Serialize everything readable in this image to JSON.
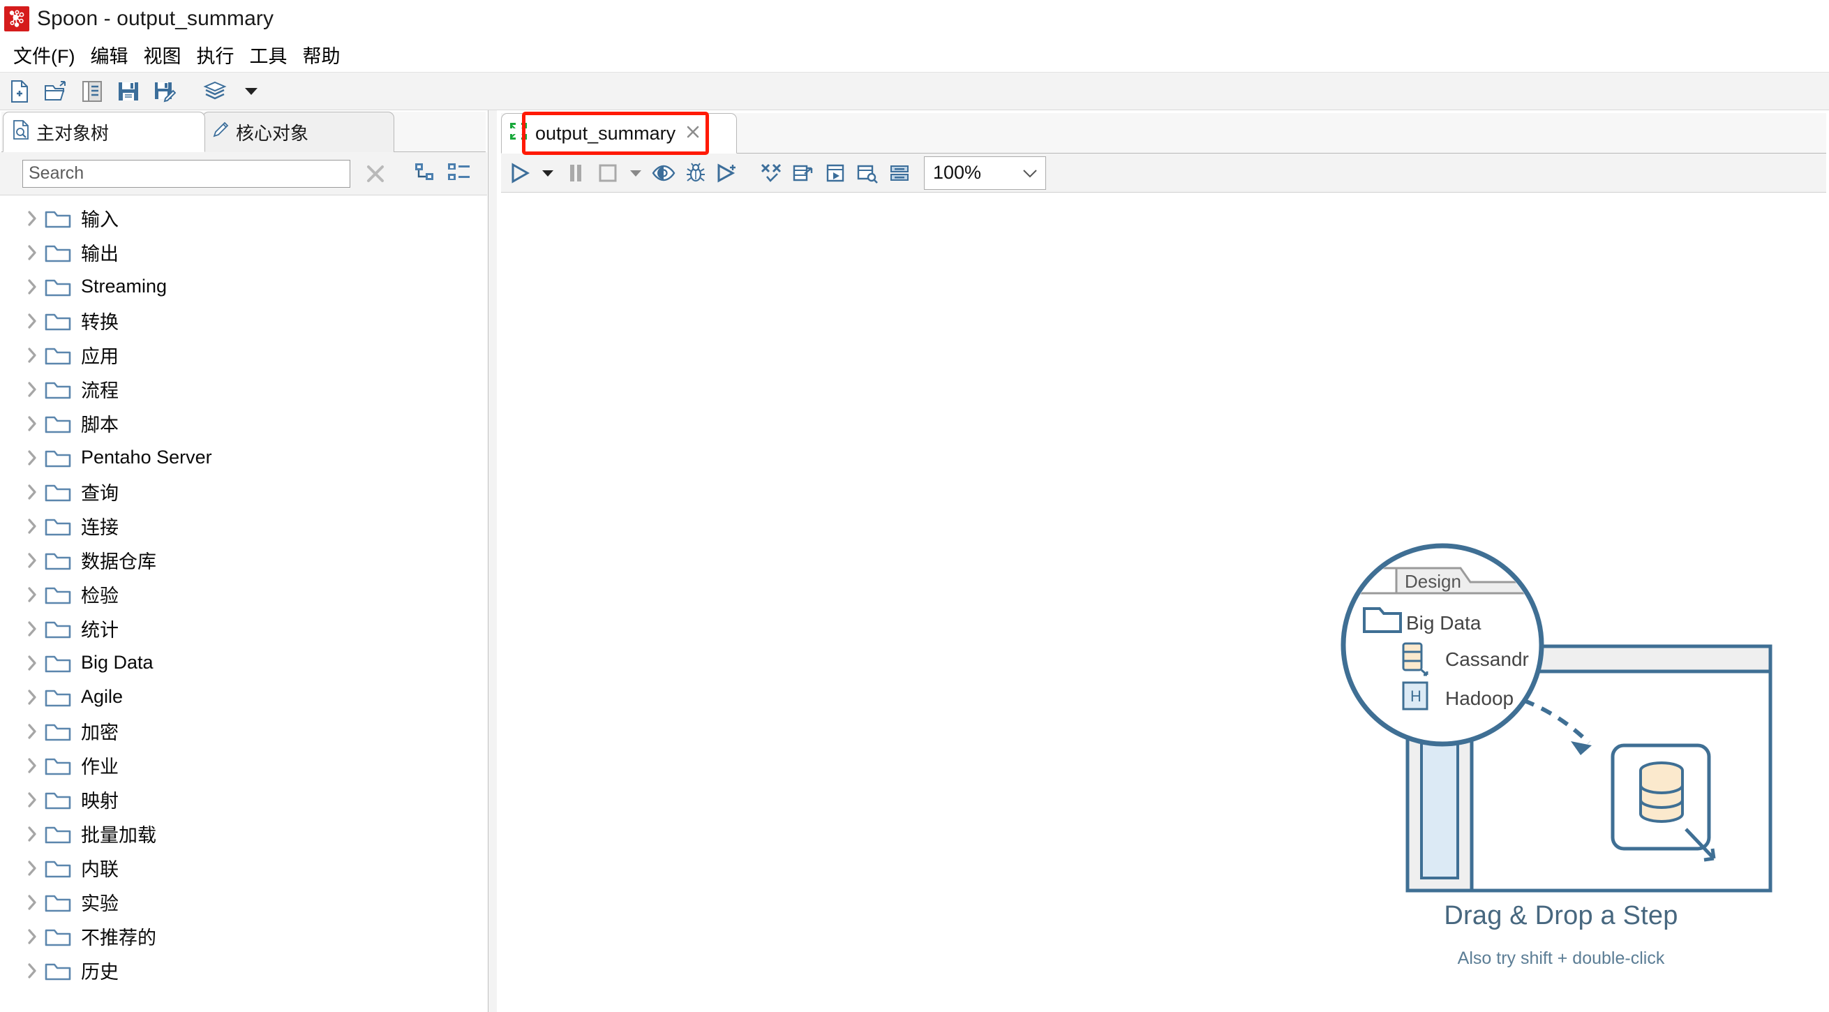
{
  "window": {
    "title": "Spoon - output_summary",
    "logo_icon": "pentaho-spoon-logo"
  },
  "menubar": {
    "items": [
      {
        "label": "文件(F)",
        "name": "menu-file"
      },
      {
        "label": "编辑",
        "name": "menu-edit"
      },
      {
        "label": "视图",
        "name": "menu-view"
      },
      {
        "label": "执行",
        "name": "menu-run"
      },
      {
        "label": "工具",
        "name": "menu-tools"
      },
      {
        "label": "帮助",
        "name": "menu-help"
      }
    ]
  },
  "toolbar": {
    "buttons": [
      {
        "icon": "new-file-icon",
        "name": "new-button"
      },
      {
        "icon": "open-folder-icon",
        "name": "open-button"
      },
      {
        "icon": "explorer-icon",
        "name": "explore-repository-button"
      },
      {
        "icon": "save-icon",
        "name": "save-button"
      },
      {
        "icon": "save-as-icon",
        "name": "save-as-button"
      },
      {
        "icon": "layers-icon",
        "name": "perspective-button"
      },
      {
        "icon": "chevron-down-icon",
        "name": "perspective-dropdown"
      }
    ]
  },
  "sidebar": {
    "tabs": [
      {
        "label": "主对象树",
        "icon": "document-search-icon",
        "active": true,
        "name": "tab-main-object-tree"
      },
      {
        "label": "核心对象",
        "icon": "pencil-icon",
        "active": false,
        "name": "tab-core-objects"
      }
    ],
    "search": {
      "value": "",
      "placeholder": "Search",
      "clear_icon": "close-x-icon",
      "tools": [
        {
          "icon": "expand-tree-icon",
          "name": "expand-all-button"
        },
        {
          "icon": "collapse-tree-icon",
          "name": "collapse-all-button"
        }
      ]
    },
    "tree_items": [
      {
        "label": "输入"
      },
      {
        "label": "输出"
      },
      {
        "label": "Streaming"
      },
      {
        "label": "转换"
      },
      {
        "label": "应用"
      },
      {
        "label": "流程"
      },
      {
        "label": "脚本"
      },
      {
        "label": "Pentaho Server"
      },
      {
        "label": "查询"
      },
      {
        "label": "连接"
      },
      {
        "label": "数据仓库"
      },
      {
        "label": "检验"
      },
      {
        "label": "统计"
      },
      {
        "label": "Big Data"
      },
      {
        "label": "Agile"
      },
      {
        "label": "加密"
      },
      {
        "label": "作业"
      },
      {
        "label": "映射"
      },
      {
        "label": "批量加载"
      },
      {
        "label": "内联"
      },
      {
        "label": "实验"
      },
      {
        "label": "不推荐的"
      },
      {
        "label": "历史"
      }
    ]
  },
  "editor": {
    "tab": {
      "label": "output_summary",
      "icon": "transformation-icon",
      "close_icon": "close-x-icon",
      "highlighted": true,
      "highlight_color": "#ff1a05"
    },
    "toolbar": {
      "buttons": [
        {
          "icon": "play-icon",
          "name": "run-button"
        },
        {
          "icon": "chevron-down-icon",
          "name": "run-options-dropdown"
        },
        {
          "icon": "pause-icon",
          "name": "pause-button"
        },
        {
          "icon": "stop-icon",
          "name": "stop-button"
        },
        {
          "icon": "chevron-down-icon",
          "name": "stop-options-dropdown"
        },
        {
          "icon": "preview-eye-icon",
          "name": "preview-button"
        },
        {
          "icon": "bug-icon",
          "name": "debug-button"
        },
        {
          "icon": "play-replay-icon",
          "name": "replay-button"
        },
        {
          "icon": "collapse-arrows-icon",
          "name": "arrange-button"
        },
        {
          "icon": "database-export-icon",
          "name": "show-results-button"
        },
        {
          "icon": "database-run-icon",
          "name": "execution-results-button"
        },
        {
          "icon": "database-search-icon",
          "name": "metrics-button"
        },
        {
          "icon": "grid-rows-icon",
          "name": "preview-data-button"
        }
      ],
      "zoom": {
        "value": "100%",
        "dropdown_icon": "chevron-down-icon"
      }
    },
    "canvas": {
      "empty_state": {
        "title": "Drag & Drop a Step",
        "subtitle": "Also try shift + double-click",
        "magnifier": {
          "tab_label": "Design",
          "items": [
            {
              "label": "Big Data",
              "icon": "folder-icon"
            },
            {
              "label": "Cassandr",
              "icon": "cassandra-db-icon"
            },
            {
              "label": "Hadoop",
              "icon": "hadoop-h-icon"
            }
          ]
        }
      }
    }
  },
  "colors": {
    "brand_red": "#d51c1c",
    "highlight_red": "#ff1a05",
    "icon_blue": "#3c6e9a",
    "empty_state_blue": "#47677f",
    "toolbar_bg": "#f3f3f3"
  }
}
